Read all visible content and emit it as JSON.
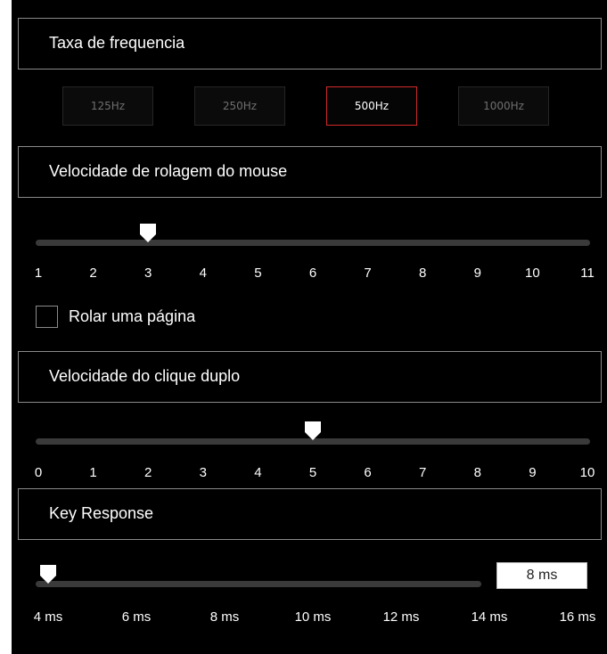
{
  "sections": {
    "frequency": {
      "title": "Taxa de frequencia",
      "options": [
        "125Hz",
        "250Hz",
        "500Hz",
        "1000Hz"
      ],
      "selected": "500Hz"
    },
    "scroll": {
      "title": "Velocidade de rolagem do mouse",
      "min": 1,
      "max": 11,
      "value": 3,
      "ticks": [
        "1",
        "2",
        "3",
        "4",
        "5",
        "6",
        "7",
        "8",
        "9",
        "10",
        "11"
      ],
      "checkbox_label": "Rolar uma página",
      "checkbox_checked": false
    },
    "double_click": {
      "title": "Velocidade do clique duplo",
      "min": 0,
      "max": 10,
      "value": 5,
      "ticks": [
        "0",
        "1",
        "2",
        "3",
        "4",
        "5",
        "6",
        "7",
        "8",
        "9",
        "10"
      ]
    },
    "key_response": {
      "title": "Key Response",
      "min": 4,
      "max": 16,
      "value": 4,
      "value_display": "8 ms",
      "ticks": [
        "4 ms",
        "6 ms",
        "8 ms",
        "10 ms",
        "12 ms",
        "14 ms",
        "16 ms"
      ]
    }
  },
  "colors": {
    "background": "#000000",
    "border": "#8a8a8a",
    "selected_border": "#d42a2a",
    "track": "#3a3a3a",
    "thumb": "#ffffff"
  }
}
